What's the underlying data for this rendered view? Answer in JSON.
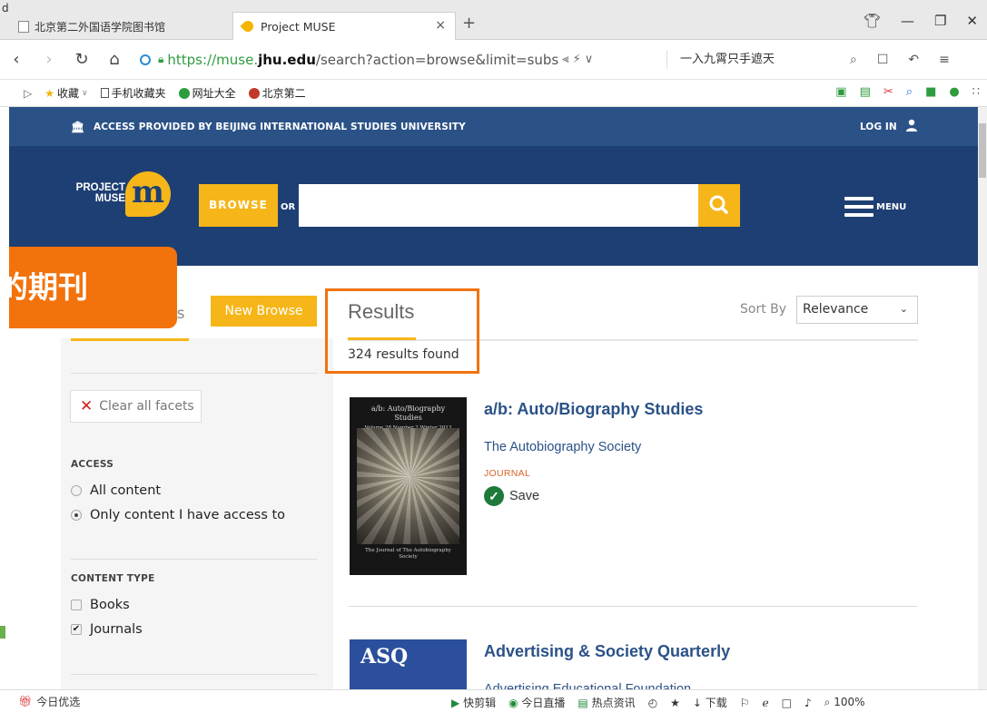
{
  "browser": {
    "corner_letter": "d",
    "tabs": [
      {
        "label": "北京第二外国语学院图书馆"
      },
      {
        "label": "Project MUSE",
        "close": "×"
      }
    ],
    "new_tab": "+",
    "url_scheme": "https://muse.",
    "url_host": "jhu.edu",
    "url_path": "/search?action=browse&limit=subs­",
    "search_box_text": "一入九霄只手遮天",
    "bookmarks": [
      {
        "label": "收藏",
        "icon": "star-icon"
      },
      {
        "label": "手机收藏夹",
        "icon": "phone-icon"
      },
      {
        "label": "网址大全",
        "icon": "globe-icon"
      },
      {
        "label": "北京第二",
        "icon": "site-icon"
      }
    ]
  },
  "site": {
    "access_text": "ACCESS PROVIDED BY BEIJING INTERNATIONAL STUDIES UNIVERSITY",
    "login_label": "LOG IN",
    "logo_text_line1": "PROJECT",
    "logo_text_line2": "MUSE",
    "logo_letter": "m",
    "browse_label": "BROWSE",
    "or_label": "OR",
    "menu_label": "MENU",
    "colors": {
      "brand_blue": "#1e3f73",
      "bar_blue": "#2b5287",
      "accent_gold": "#f6b619",
      "callout_orange": "#f2720c"
    }
  },
  "overlay": {
    "callout_text": "的期刊"
  },
  "sidebar": {
    "facets_tab_fragment": "ts",
    "new_browse_label": "New Browse",
    "clear_label": "Clear all facets",
    "access_heading": "ACCESS",
    "access_options": [
      {
        "label": "All content",
        "selected": false
      },
      {
        "label": "Only content I have access to",
        "selected": true
      }
    ],
    "content_type_heading": "CONTENT TYPE",
    "content_type_options": [
      {
        "label": "Books",
        "checked": false
      },
      {
        "label": "Journals",
        "checked": true
      }
    ]
  },
  "results": {
    "title": "Results",
    "count_text": "324 results found",
    "sort_label": "Sort By",
    "sort_value": "Relevance",
    "items": [
      {
        "title": "a/b: Auto/Biography Studies",
        "publisher": "The Autobiography Society",
        "type": "JOURNAL",
        "save_label": "Save",
        "cover_top": "a/b: Auto/Biography Studies",
        "cover_meta": "Volume 28    Number 2    Winter 2013",
        "cover_bottom": "The Journal of The Autobiography Society"
      },
      {
        "title": "Advertising & Society Quarterly",
        "publisher": "Advertising Educational Foundation",
        "cover_text": "ASQ"
      }
    ]
  },
  "statusbar": {
    "left_label": "今日优选",
    "items": [
      "快剪辑",
      "今日直播",
      "热点资讯",
      "下载"
    ],
    "zoom": "100%"
  }
}
